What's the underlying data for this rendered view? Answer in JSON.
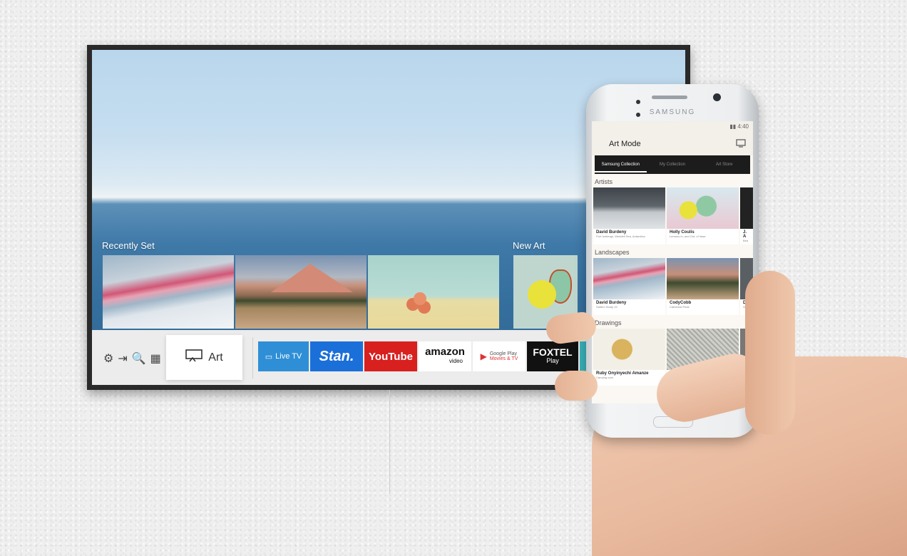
{
  "tv": {
    "rows": {
      "recently_set": "Recently Set",
      "new_art": "New Art"
    },
    "system_icons": [
      "⚙",
      "⇥",
      "🔍",
      "▦"
    ],
    "art_label": "Art",
    "apps": {
      "live_tv": "Live TV",
      "stan": "Stan.",
      "youtube": "YouTube",
      "amazon_line1": "amazon",
      "amazon_line2": "video",
      "google_play_line1": "Google Play",
      "google_play_line2": "Movies & TV",
      "foxtel_line1": "FOXTEL",
      "foxtel_line2": "Play"
    }
  },
  "phone": {
    "brand": "SAMSUNG",
    "status_time": "4:40",
    "title": "Art Mode",
    "tabs": [
      "Samsung Collection",
      "My Collection",
      "Art Store"
    ],
    "sections": [
      {
        "title": "Artists",
        "cards": [
          {
            "name": "David Burdeny",
            "sub": "Five Icebergs, Weddell Sea, Antarctica"
          },
          {
            "name": "Holly Coulis",
            "sub": "Lemons In, and Out, of Vase"
          },
          {
            "name": "J. A",
            "sub": "Bea"
          }
        ]
      },
      {
        "title": "Landscapes",
        "cards": [
          {
            "name": "David Burdeny",
            "sub": "Saltern Study 19"
          },
          {
            "name": "CodyCobb",
            "sub": "Cathedral Peak"
          },
          {
            "name": "Dav",
            "sub": "Spri"
          }
        ]
      },
      {
        "title": "Drawings",
        "cards": [
          {
            "name": "Ruby Onyinyechi Amanze",
            "sub": "Carrying ours"
          },
          {
            "name": "",
            "sub": ""
          },
          {
            "name": "",
            "sub": ""
          }
        ]
      }
    ]
  }
}
